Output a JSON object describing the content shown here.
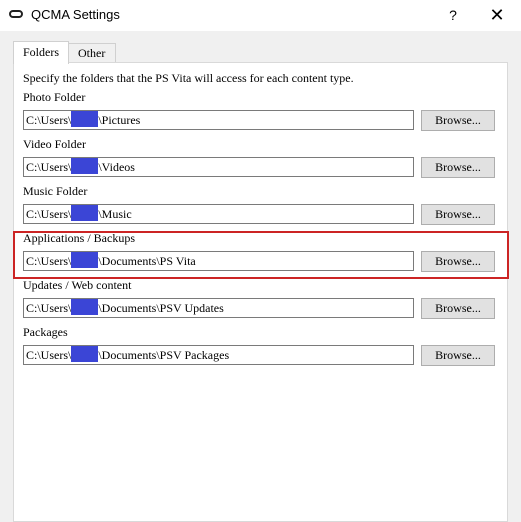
{
  "window": {
    "title": "QCMA Settings",
    "help_label": "?",
    "close_label": "✕"
  },
  "tabs": [
    {
      "label": "Folders",
      "active": true
    },
    {
      "label": "Other",
      "active": false
    }
  ],
  "intro": "Specify the folders that the PS Vita will access for each content type.",
  "browse_label": "Browse...",
  "redaction_color": "#3b45d6",
  "highlight_color": "#cc2424",
  "folders": [
    {
      "label": "Photo Folder",
      "path_prefix": "C:\\Users\\",
      "path_suffix": "\\Pictures"
    },
    {
      "label": "Video Folder",
      "path_prefix": "C:\\Users\\",
      "path_suffix": "\\Videos"
    },
    {
      "label": "Music Folder",
      "path_prefix": "C:\\Users\\",
      "path_suffix": "\\Music"
    },
    {
      "label": "Applications / Backups",
      "path_prefix": "C:\\Users\\",
      "path_suffix": "\\Documents\\PS Vita",
      "highlighted": true
    },
    {
      "label": "Updates / Web content",
      "path_prefix": "C:\\Users\\",
      "path_suffix": "\\Documents\\PSV Updates"
    },
    {
      "label": "Packages",
      "path_prefix": "C:\\Users\\",
      "path_suffix": "\\Documents\\PSV Packages"
    }
  ]
}
